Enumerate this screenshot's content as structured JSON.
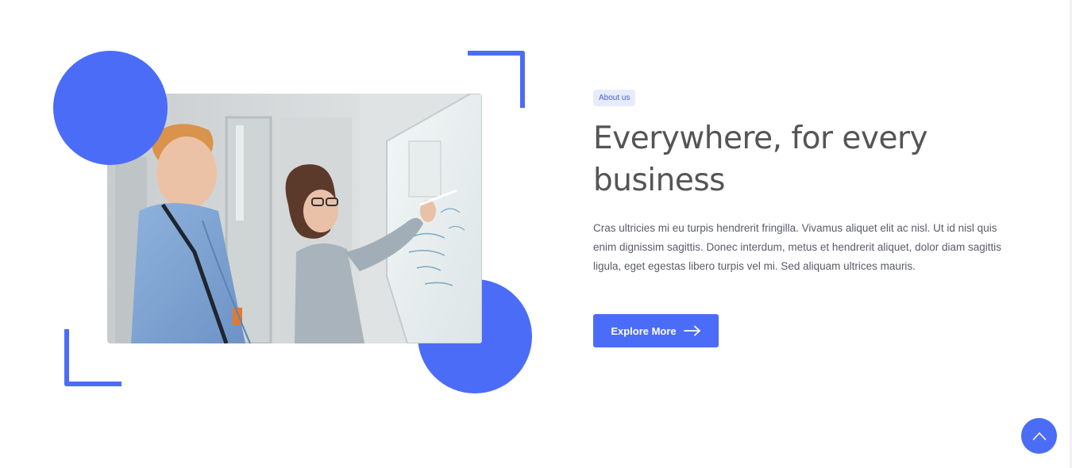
{
  "colors": {
    "accent": "#4a6cf7",
    "heading": "#555555",
    "body_text": "#5b5b6b",
    "tag_bg": "#e6ecfd",
    "tag_text": "#4a5ec4"
  },
  "about": {
    "tag": "About us",
    "headline": "Everywhere, for every business",
    "description": "Cras ultricies mi eu turpis hendrerit fringilla. Vivamus aliquet elit ac nisl. Ut id nisl quis enim dignissim sagittis. Donec interdum, metus et hendrerit aliquet, dolor diam sagittis ligula, eget egestas libero turpis vel mi. Sed aliquam ultrices mauris.",
    "cta_label": "Explore More",
    "cta_icon": "arrow-right-icon",
    "image_icon": "team-whiteboard-photo"
  },
  "scroll_top": {
    "icon": "chevron-up-icon"
  }
}
